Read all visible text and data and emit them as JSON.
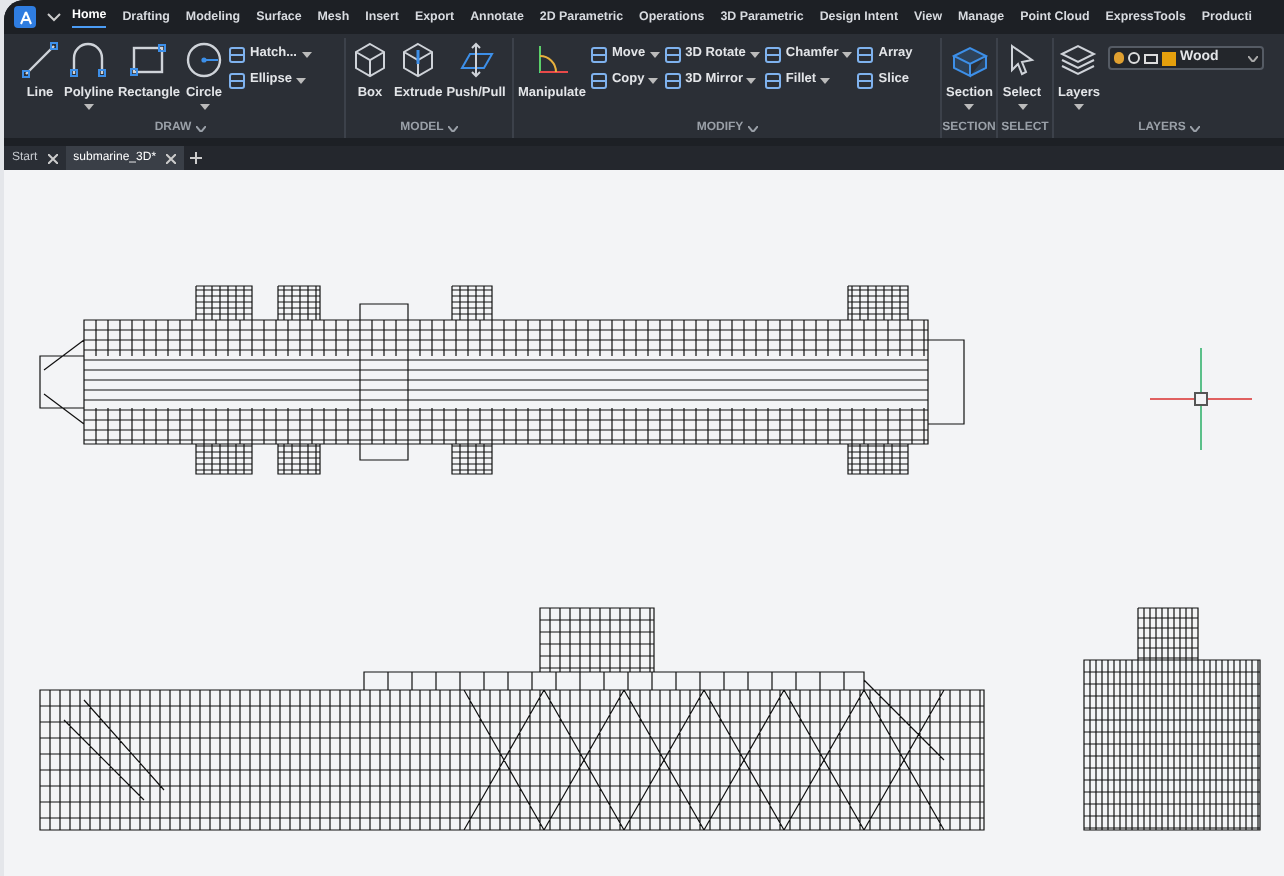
{
  "menu_tabs": [
    {
      "label": "Home",
      "selected": true
    },
    {
      "label": "Drafting",
      "selected": false
    },
    {
      "label": "Modeling",
      "selected": false
    },
    {
      "label": "Surface",
      "selected": false
    },
    {
      "label": "Mesh",
      "selected": false
    },
    {
      "label": "Insert",
      "selected": false
    },
    {
      "label": "Export",
      "selected": false
    },
    {
      "label": "Annotate",
      "selected": false
    },
    {
      "label": "2D Parametric",
      "selected": false
    },
    {
      "label": "Operations",
      "selected": false
    },
    {
      "label": "3D Parametric",
      "selected": false
    },
    {
      "label": "Design Intent",
      "selected": false
    },
    {
      "label": "View",
      "selected": false
    },
    {
      "label": "Manage",
      "selected": false
    },
    {
      "label": "Point Cloud",
      "selected": false
    },
    {
      "label": "ExpressTools",
      "selected": false
    },
    {
      "label": "Producti",
      "selected": false
    }
  ],
  "ribbon_panels": [
    {
      "title": "DRAW",
      "large_tools": [
        {
          "label": "Line",
          "dropdown": false
        },
        {
          "label": "Polyline",
          "dropdown": true
        },
        {
          "label": "Rectangle",
          "dropdown": false
        },
        {
          "label": "Circle",
          "dropdown": true
        }
      ],
      "small_tools": [
        {
          "label": "Hatch...",
          "dropdown": true
        },
        {
          "label": "Ellipse",
          "dropdown": true
        }
      ]
    },
    {
      "title": "MODEL",
      "large_tools": [
        {
          "label": "Box",
          "dropdown": false
        },
        {
          "label": "Extrude",
          "dropdown": false
        },
        {
          "label": "Push/Pull",
          "dropdown": false
        }
      ]
    },
    {
      "title": "MODIFY",
      "large_tools": [
        {
          "label": "Manipulate",
          "dropdown": false
        }
      ],
      "small_tools": [
        {
          "label": "Move",
          "dropdown": true
        },
        {
          "label": "Copy",
          "dropdown": true
        },
        {
          "label": "3D Rotate",
          "dropdown": true
        },
        {
          "label": "3D Mirror",
          "dropdown": true
        },
        {
          "label": "Chamfer",
          "dropdown": true
        },
        {
          "label": "Fillet",
          "dropdown": true
        },
        {
          "label": "Array",
          "dropdown": false
        },
        {
          "label": "Slice",
          "dropdown": false
        }
      ]
    },
    {
      "title": "SECTION",
      "large_tools": [
        {
          "label": "Section",
          "dropdown": true
        }
      ]
    },
    {
      "title": "SELECT",
      "large_tools": [
        {
          "label": "Select",
          "dropdown": true
        }
      ]
    },
    {
      "title": "LAYERS",
      "large_tools": [
        {
          "label": "Layers",
          "dropdown": true
        }
      ],
      "layer_dropdown": {
        "value": "Wood"
      }
    }
  ],
  "document_tabs": [
    {
      "label": "Start",
      "selected": false
    },
    {
      "label": "submarine_3D*",
      "selected": true
    }
  ]
}
